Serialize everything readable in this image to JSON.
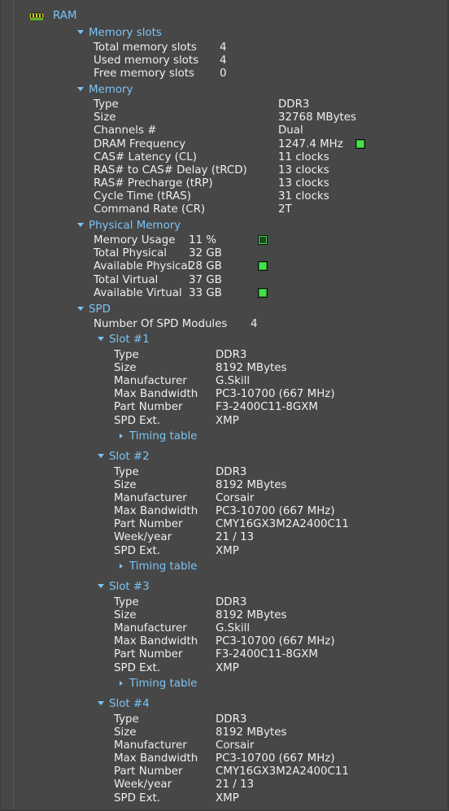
{
  "root": {
    "label": "RAM"
  },
  "memory_slots": {
    "header": "Memory slots",
    "rows": [
      {
        "label": "Total memory slots",
        "value": "4"
      },
      {
        "label": "Used memory slots",
        "value": "4"
      },
      {
        "label": "Free memory slots",
        "value": "0"
      }
    ]
  },
  "memory": {
    "header": "Memory",
    "rows": [
      {
        "label": "Type",
        "value": "DDR3"
      },
      {
        "label": "Size",
        "value": "32768 MBytes"
      },
      {
        "label": "Channels #",
        "value": "Dual"
      },
      {
        "label": "DRAM Frequency",
        "value": "1247.4 MHz"
      },
      {
        "label": "CAS# Latency (CL)",
        "value": "11 clocks"
      },
      {
        "label": "RAS# to CAS# Delay (tRCD)",
        "value": "13 clocks"
      },
      {
        "label": "RAS# Precharge (tRP)",
        "value": "13 clocks"
      },
      {
        "label": "Cycle Time (tRAS)",
        "value": "31 clocks"
      },
      {
        "label": "Command Rate (CR)",
        "value": "2T"
      }
    ]
  },
  "physical_memory": {
    "header": "Physical Memory",
    "rows": [
      {
        "label": "Memory Usage",
        "value": "11 %"
      },
      {
        "label": "Total Physical",
        "value": "32 GB"
      },
      {
        "label": "Available Physical",
        "value": "28 GB"
      },
      {
        "label": "Total Virtual",
        "value": "37 GB"
      },
      {
        "label": "Available Virtual",
        "value": "33 GB"
      }
    ]
  },
  "spd": {
    "header": "SPD",
    "modules_label": "Number Of SPD Modules",
    "modules_value": "4",
    "timing_label": "Timing table",
    "slots": [
      {
        "header": "Slot #1",
        "rows": [
          {
            "label": "Type",
            "value": "DDR3"
          },
          {
            "label": "Size",
            "value": "8192 MBytes"
          },
          {
            "label": "Manufacturer",
            "value": "G.Skill"
          },
          {
            "label": "Max Bandwidth",
            "value": "PC3-10700 (667 MHz)"
          },
          {
            "label": "Part Number",
            "value": "F3-2400C11-8GXM"
          },
          {
            "label": "SPD Ext.",
            "value": "XMP"
          }
        ]
      },
      {
        "header": "Slot #2",
        "rows": [
          {
            "label": "Type",
            "value": "DDR3"
          },
          {
            "label": "Size",
            "value": "8192 MBytes"
          },
          {
            "label": "Manufacturer",
            "value": "Corsair"
          },
          {
            "label": "Max Bandwidth",
            "value": "PC3-10700 (667 MHz)"
          },
          {
            "label": "Part Number",
            "value": "CMY16GX3M2A2400C11"
          },
          {
            "label": "Week/year",
            "value": "21 / 13"
          },
          {
            "label": "SPD Ext.",
            "value": "XMP"
          }
        ]
      },
      {
        "header": "Slot #3",
        "rows": [
          {
            "label": "Type",
            "value": "DDR3"
          },
          {
            "label": "Size",
            "value": "8192 MBytes"
          },
          {
            "label": "Manufacturer",
            "value": "G.Skill"
          },
          {
            "label": "Max Bandwidth",
            "value": "PC3-10700 (667 MHz)"
          },
          {
            "label": "Part Number",
            "value": "F3-2400C11-8GXM"
          },
          {
            "label": "SPD Ext.",
            "value": "XMP"
          }
        ]
      },
      {
        "header": "Slot #4",
        "rows": [
          {
            "label": "Type",
            "value": "DDR3"
          },
          {
            "label": "Size",
            "value": "8192 MBytes"
          },
          {
            "label": "Manufacturer",
            "value": "Corsair"
          },
          {
            "label": "Max Bandwidth",
            "value": "PC3-10700 (667 MHz)"
          },
          {
            "label": "Part Number",
            "value": "CMY16GX3M2A2400C11"
          },
          {
            "label": "Week/year",
            "value": "21 / 13"
          },
          {
            "label": "SPD Ext.",
            "value": "XMP"
          }
        ]
      }
    ]
  },
  "colors": {
    "background": "#474747",
    "header_text": "#7cc4f4",
    "body_text": "#efefef",
    "indicator_green": "#43e24a"
  }
}
